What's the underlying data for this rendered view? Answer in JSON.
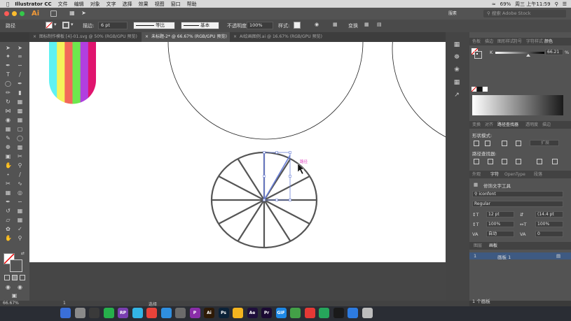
{
  "menubar": {
    "app_name": "Illustrator CC",
    "menus": [
      "文件",
      "编辑",
      "对象",
      "文字",
      "选择",
      "效果",
      "视图",
      "窗口",
      "帮助"
    ],
    "battery": "69%",
    "clock": "周三 上午11:59"
  },
  "appbar": {
    "logo": "Ai",
    "br_label": "Br",
    "workspace": "服素",
    "stock_placeholder": "搜索 Adobe Stock"
  },
  "control": {
    "selection_label": "路径",
    "stroke_label": "描边:",
    "stroke_weight": "6 pt",
    "profile_label": "等比",
    "brush_label": "基本",
    "opacity_label": "不透明度:",
    "opacity_value": "100%",
    "style_label": "样式:",
    "transform_label": "变换"
  },
  "tabs": [
    {
      "label": "图标制作模板 [4]-01.svg @ 50% (RGB/GPU 预览)",
      "close": "×"
    },
    {
      "label": "未标题-2* @ 66.67% (RGB/GPU 预览)",
      "close": "×"
    },
    {
      "label": "AI绘画图例.ai @ 16.67% (RGB/GPU 预览)",
      "close": "×"
    }
  ],
  "canvas": {
    "smart_guide_label": "路径",
    "stripe_colors": [
      "#5ff2f2",
      "#f5f25a",
      "#f2685a",
      "#6de84d",
      "#b13fe0",
      "#e0146e"
    ],
    "wheel_stroke": "#555555",
    "selection_color": "#6a7fd8",
    "smart_guide_color": "#e040c0"
  },
  "color_panel": {
    "tabs": [
      "色板",
      "描边",
      "图形样式",
      "符号",
      "字符样式",
      "颜色"
    ],
    "channel": "K",
    "value": "66.21",
    "unit": "%"
  },
  "transform_panel": {
    "tabs": [
      "变换",
      "对齐",
      "路径查找器",
      "透明度",
      "描边"
    ],
    "shape_modes_label": "形状模式:",
    "expand_button": "扩展",
    "pathfinder_label": "路径查找器:"
  },
  "character_panel": {
    "tabs": [
      "外观",
      "字符",
      "OpenType",
      "段落"
    ],
    "touch_type": "修饰文字工具",
    "font_family": "iconfont",
    "font_style": "Regular",
    "font_size": "12 pt",
    "leading": "(14.4 pt",
    "vscale": "100%",
    "hscale": "100%",
    "kerning": "自动",
    "tracking": "0"
  },
  "layers_panel": {
    "tabs": [
      "图层",
      "画板"
    ],
    "row_index": "1",
    "row_name": "画板 1",
    "count": "1 个画板"
  },
  "status": {
    "zoom": "66.67%",
    "artboard_nav": "1",
    "mode": "选择"
  },
  "dock": {
    "apps": [
      {
        "label": "",
        "color": "#3a6fd8"
      },
      {
        "label": "",
        "color": "#8a8a8a"
      },
      {
        "label": "",
        "color": "#3a3a3a"
      },
      {
        "label": "",
        "color": "#26b04b"
      },
      {
        "label": "RP",
        "color": "#7a3fb0"
      },
      {
        "label": "",
        "color": "#33b5e5"
      },
      {
        "label": "",
        "color": "#e8433a"
      },
      {
        "label": "",
        "color": "#2f8fe0"
      },
      {
        "label": "",
        "color": "#6b6b6b"
      },
      {
        "label": "P",
        "color": "#8a2ea8"
      },
      {
        "label": "Ai",
        "color": "#2e1a06"
      },
      {
        "label": "Ps",
        "color": "#0b2238"
      },
      {
        "label": "",
        "color": "#f3b41f"
      },
      {
        "label": "Ae",
        "color": "#1f0f3c"
      },
      {
        "label": "Pr",
        "color": "#1b0a33"
      },
      {
        "label": "GIF",
        "color": "#1e88e5"
      },
      {
        "label": "",
        "color": "#43a047"
      },
      {
        "label": "",
        "color": "#e53935"
      },
      {
        "label": "",
        "color": "#26a65b"
      },
      {
        "label": "",
        "color": "#1a1a1a"
      },
      {
        "label": "",
        "color": "#2d7be0"
      },
      {
        "label": "",
        "color": "#bdbdbd"
      }
    ]
  }
}
